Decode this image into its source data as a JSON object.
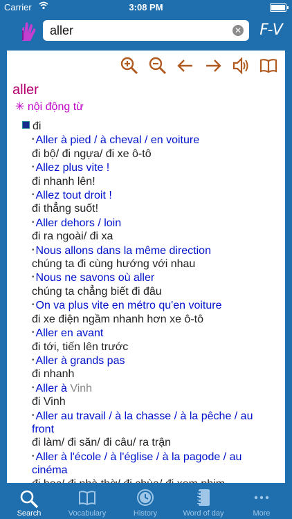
{
  "status": {
    "carrier": "Carrier",
    "time": "3:08 PM"
  },
  "search": {
    "value": "aller"
  },
  "header": {
    "mode": "F-V"
  },
  "entry": {
    "word": "aller",
    "pos": "✳ nội động từ",
    "heading": "đi",
    "lines": [
      {
        "cls": "fr",
        "b": "•",
        "t": "Aller à pied / à cheval / en voiture"
      },
      {
        "cls": "vi",
        "b": "",
        "t": "đi bộ/ đi ngựa/ đi xe ô-tô"
      },
      {
        "cls": "fr",
        "b": "•",
        "t": "Allez plus vite !"
      },
      {
        "cls": "vi",
        "b": "",
        "t": "đi nhanh lên!"
      },
      {
        "cls": "fr",
        "b": "•",
        "t": "Allez tout droit !"
      },
      {
        "cls": "vi",
        "b": "",
        "t": "đi thẳng suốt!"
      },
      {
        "cls": "fr",
        "b": "•",
        "t": "Aller dehors / loin"
      },
      {
        "cls": "vi",
        "b": "",
        "t": "đi ra ngoài/ đi xa"
      },
      {
        "cls": "fr",
        "b": "•",
        "t": "Nous allons dans la même direction"
      },
      {
        "cls": "vi",
        "b": "",
        "t": "chúng ta đi cùng hướng với nhau"
      },
      {
        "cls": "fr",
        "b": "•",
        "t": "Nous ne savons où aller"
      },
      {
        "cls": "vi",
        "b": "",
        "t": "chúng ta chẳng biết đi đâu"
      },
      {
        "cls": "fr",
        "b": "•",
        "t": "On va plus vite en métro qu'en voiture"
      },
      {
        "cls": "vi",
        "b": "",
        "t": "đi xe điện ngầm nhanh hơn xe ô-tô"
      },
      {
        "cls": "fr",
        "b": "•",
        "t": "Aller en avant"
      },
      {
        "cls": "vi",
        "b": "",
        "t": "đi tới, tiến lên trước"
      },
      {
        "cls": "fr",
        "b": "•",
        "t": "Aller à grands pas"
      },
      {
        "cls": "vi",
        "b": "",
        "t": "đi nhanh"
      },
      {
        "cls": "fr",
        "b": "•",
        "t": "Aller à",
        "g": " Vinh"
      },
      {
        "cls": "vi",
        "b": "",
        "t": "đi Vinh"
      },
      {
        "cls": "fr",
        "b": "•",
        "t": "Aller au travail / à la chasse / à la pêche / au"
      },
      {
        "cls": "fr",
        "b": "",
        "t": "front"
      },
      {
        "cls": "vi",
        "b": "",
        "t": "đi làm/ đi săn/ đi câu/ ra trận"
      },
      {
        "cls": "fr",
        "b": "•",
        "t": "Aller à l'école / à l'église / à la pagode / au"
      },
      {
        "cls": "fr",
        "b": "",
        "t": "cinéma"
      },
      {
        "cls": "vi",
        "b": "",
        "t": "đi học/ đi nhà thờ/ đi chùa/ đi xem phim"
      }
    ]
  },
  "tabs": [
    {
      "label": "Search",
      "icon": "search-icon"
    },
    {
      "label": "Vocabulary",
      "icon": "book-icon"
    },
    {
      "label": "History",
      "icon": "clock-icon"
    },
    {
      "label": "Word of day",
      "icon": "notebook-icon"
    },
    {
      "label": "More",
      "icon": "more-icon"
    }
  ],
  "colors": {
    "bar": "#1f6fae",
    "accent": "#b05a20",
    "word": "#b40070",
    "french": "#0011cc"
  }
}
